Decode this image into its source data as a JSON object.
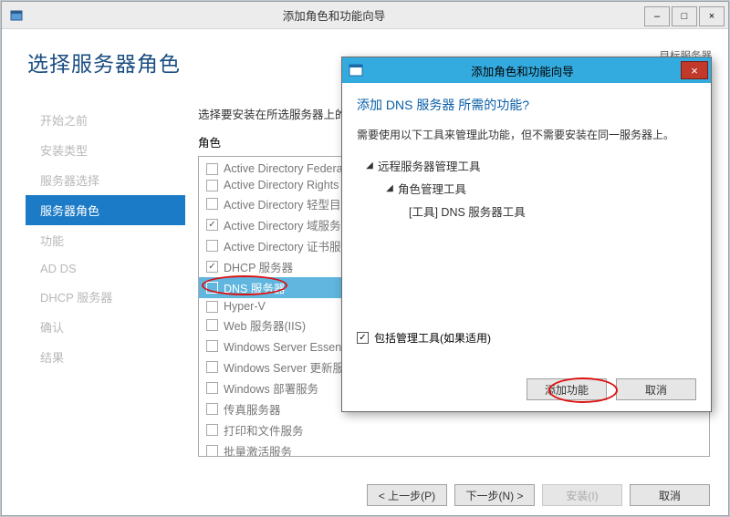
{
  "outer_window": {
    "title": "添加角色和功能向导",
    "min_btn": "–",
    "max_btn": "□",
    "close_btn": "×"
  },
  "main": {
    "heading": "选择服务器角色",
    "dest_label": "目标服务器",
    "content_hint": "选择要安装在所选服务器上的一个或多个角色。",
    "roles_label": "角色"
  },
  "nav": {
    "items": [
      {
        "label": "开始之前"
      },
      {
        "label": "安装类型"
      },
      {
        "label": "服务器选择"
      },
      {
        "label": "服务器角色"
      },
      {
        "label": "功能"
      },
      {
        "label": "AD DS"
      },
      {
        "label": "DHCP 服务器"
      },
      {
        "label": "确认"
      },
      {
        "label": "结果"
      }
    ],
    "active": 3
  },
  "roles": [
    {
      "label": "Active Directory Federation Services",
      "checked": false
    },
    {
      "label": "Active Directory Rights Management Services",
      "checked": false
    },
    {
      "label": "Active Directory 轻型目录服务",
      "checked": false
    },
    {
      "label": "Active Directory 域服务",
      "checked": true
    },
    {
      "label": "Active Directory 证书服务",
      "checked": false
    },
    {
      "label": "DHCP 服务器",
      "checked": true
    },
    {
      "label": "DNS 服务器",
      "checked": false,
      "selected": true,
      "ellipse": true
    },
    {
      "label": "Hyper-V",
      "checked": false
    },
    {
      "label": "Web 服务器(IIS)",
      "checked": false
    },
    {
      "label": "Windows Server Essentials 体验",
      "checked": false
    },
    {
      "label": "Windows Server 更新服务",
      "checked": false
    },
    {
      "label": "Windows 部署服务",
      "checked": false
    },
    {
      "label": "传真服务器",
      "checked": false
    },
    {
      "label": "打印和文件服务",
      "checked": false
    },
    {
      "label": "批量激活服务",
      "checked": false
    }
  ],
  "bottom_buttons": {
    "prev": "< 上一步(P)",
    "next": "下一步(N) >",
    "install": "安装(I)",
    "cancel": "取消"
  },
  "dialog": {
    "title": "添加角色和功能向导",
    "close_btn": "×",
    "heading": "添加 DNS 服务器 所需的功能?",
    "desc": "需要使用以下工具来管理此功能，但不需要安装在同一服务器上。",
    "tree": {
      "level1": "远程服务器管理工具",
      "level2": "角色管理工具",
      "level3": "[工具] DNS 服务器工具"
    },
    "include_label": "包括管理工具(如果适用)",
    "add_btn": "添加功能",
    "cancel_btn": "取消"
  }
}
